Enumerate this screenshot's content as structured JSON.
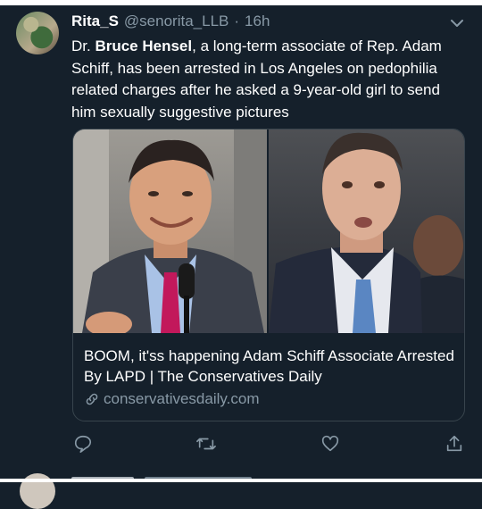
{
  "tweet": {
    "display_name": "Rita_S",
    "handle": "@senorita_LLB",
    "separator": "·",
    "time": "16h",
    "text_prefix": "Dr. ",
    "text_bold": "Bruce Hensel",
    "text_rest": ", a long-term associate of Rep. Adam Schiff, has been arrested in Los Angeles on pedophilia related charges after he asked a 9-year-old girl to send him sexually suggestive pictures"
  },
  "card": {
    "title": "BOOM, it'ss happening Adam Schiff Associate Arrested By LAPD | The Conservatives Daily",
    "domain": "conservativesdaily.com"
  },
  "icons": {
    "more": "chevron-down-icon",
    "reply": "reply-icon",
    "retweet": "retweet-icon",
    "like": "heart-icon",
    "share": "share-icon",
    "link": "link-icon"
  },
  "colors": {
    "background": "#15202b",
    "secondary_text": "#8899a6",
    "border": "#38444d"
  }
}
